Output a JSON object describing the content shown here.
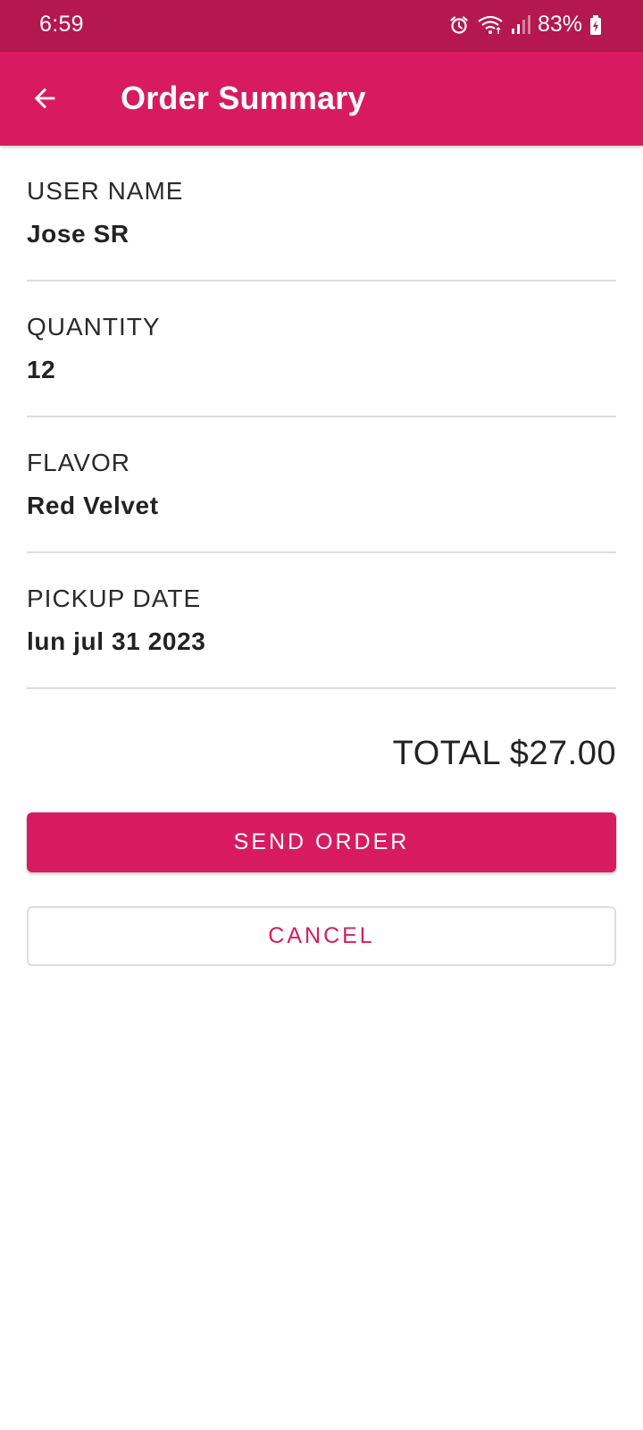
{
  "status_bar": {
    "time": "6:59",
    "battery_percent": "83%",
    "icons": [
      "alarm-icon",
      "wifi-icon",
      "signal-icon",
      "battery-charging-icon"
    ]
  },
  "app_bar": {
    "title": "Order Summary",
    "back_icon": "arrow-back-icon"
  },
  "summary": {
    "fields": [
      {
        "label": "USER NAME",
        "value": "Jose SR"
      },
      {
        "label": "QUANTITY",
        "value": "12"
      },
      {
        "label": "FLAVOR",
        "value": "Red Velvet"
      },
      {
        "label": "PICKUP DATE",
        "value": "lun jul 31 2023"
      }
    ],
    "total": "TOTAL $27.00"
  },
  "actions": {
    "send_label": "SEND ORDER",
    "cancel_label": "CANCEL"
  },
  "colors": {
    "primary": "#d81b60",
    "status_bar": "#b5174f",
    "divider": "#dcdcdc"
  }
}
